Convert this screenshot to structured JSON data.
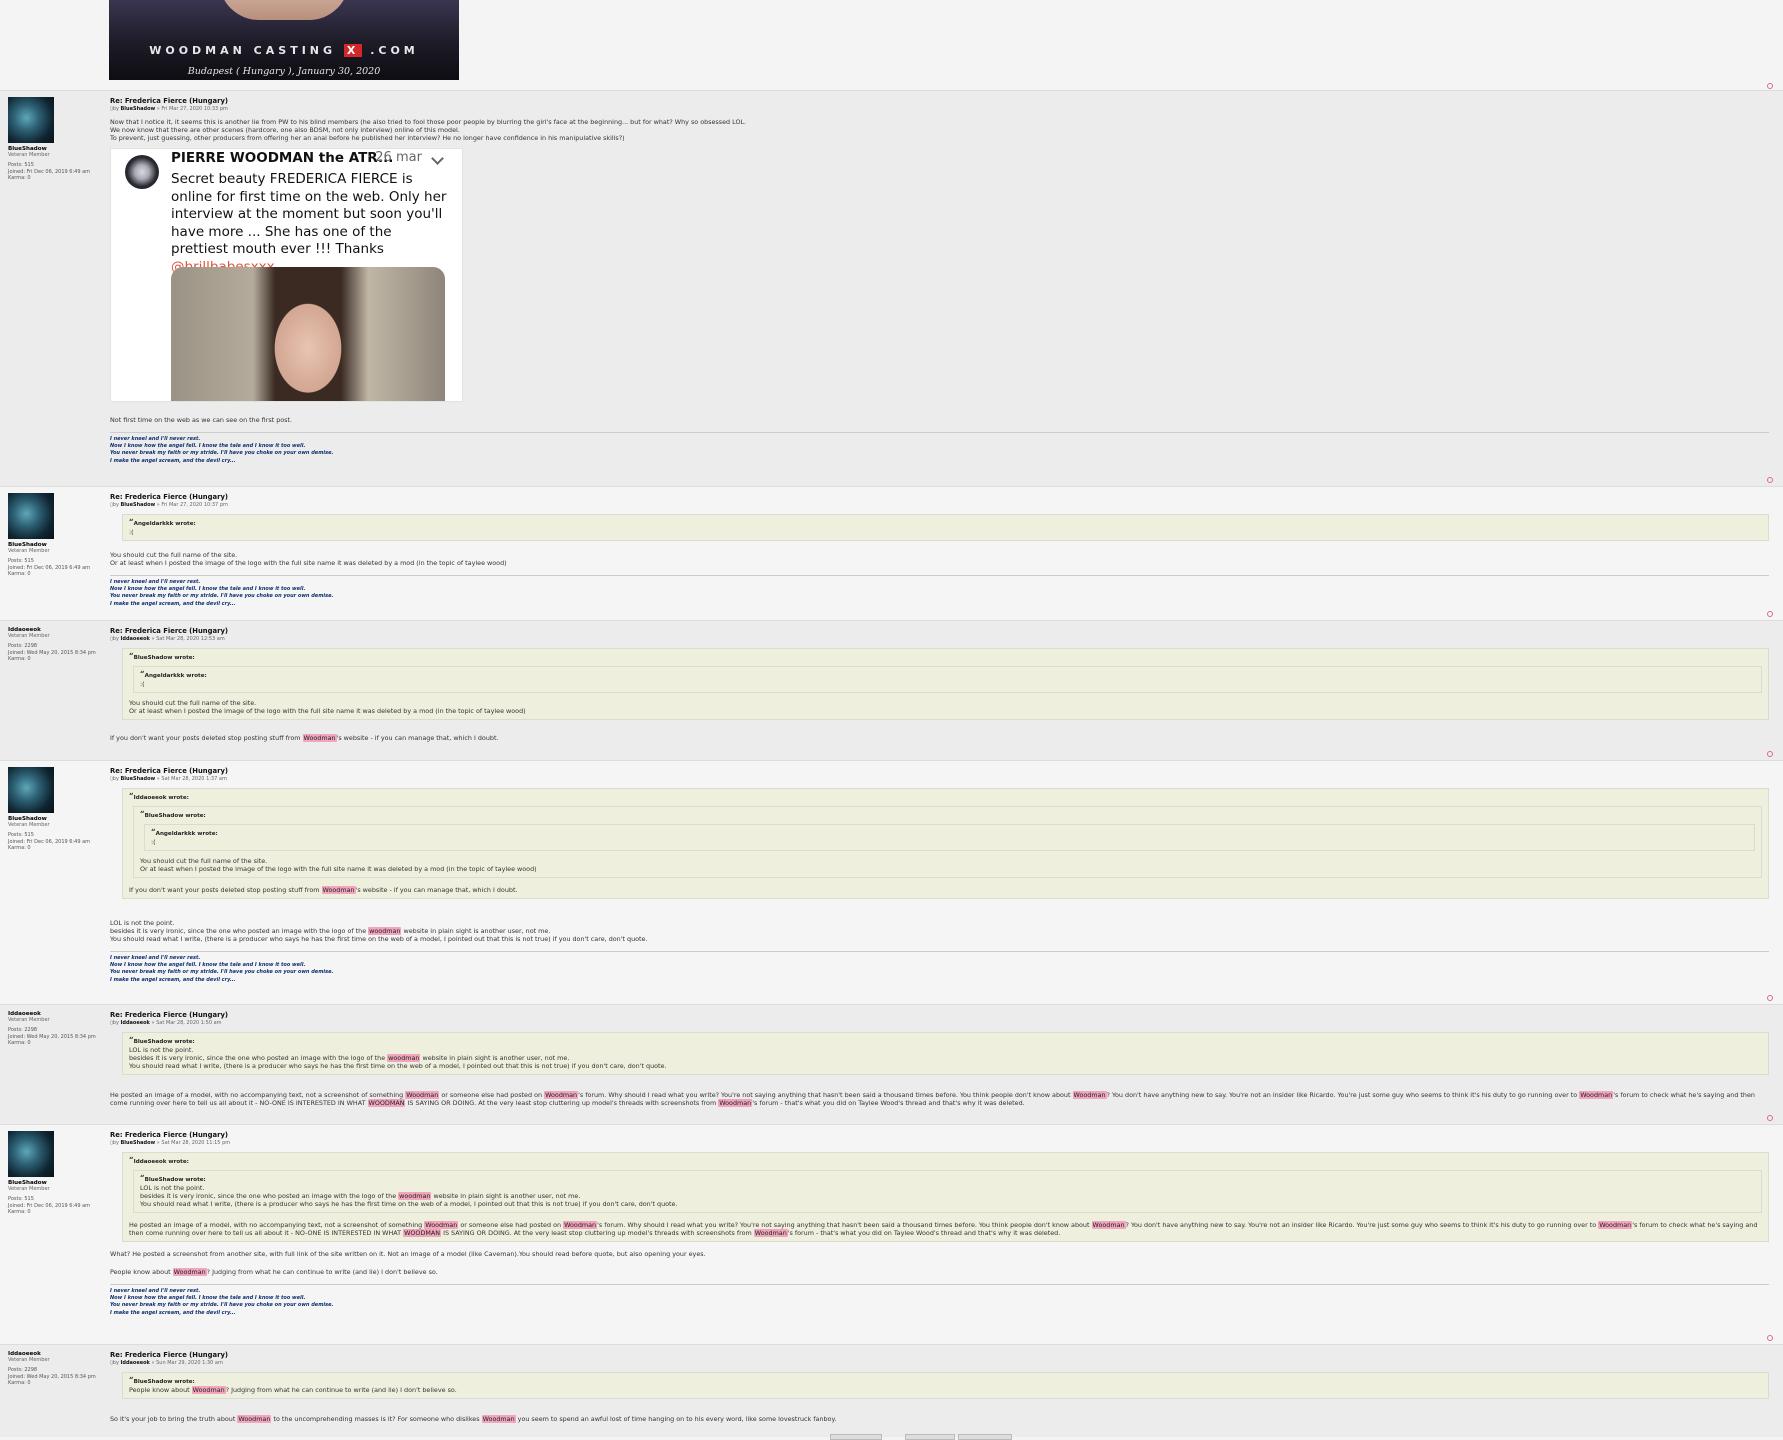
{
  "top_image": {
    "brand_prefix": "WOODMAN CASTING",
    "brand_x": "X",
    "brand_suffix": ".COM",
    "location": "Budapest ( Hungary ), January 30, 2020"
  },
  "signature": [
    "I never kneel and I'll never rest.",
    "Now I know how the angel fell. I know the tale and I know it too well.",
    "You never break my faith or my stride. I'll have you choke on your own demise.",
    "I make the angel scream, and the devil cry..."
  ],
  "users": {
    "blueshadow": {
      "name": "BlueShadow",
      "rank": "Veteran Member",
      "posts": "Posts: 515",
      "joined": "Joined: Fri Dec 06, 2019 6:49 am",
      "karma": "Karma: 0"
    },
    "iddaoeeok": {
      "name": "Iddaoeeok",
      "rank": "Veteran Member",
      "posts": "Posts: 2298",
      "joined": "Joined: Wed May 20, 2015 8:34 pm",
      "karma": "Karma: 0"
    }
  },
  "posts": [
    {
      "title": "Re: Frederica Fierce (Hungary)",
      "by": "by",
      "author": "BlueShadow",
      "date": "» Fri Mar 27, 2020 10:33 pm",
      "lines": [
        "Now that I notice it, it seems this is another lie from PW to his blind members (he also tried to fool those poor people by blurring the girl's face at the beginning... but for what? Why so obsessed LOL.",
        "We now know that there are other scenes (hardcore, one also BDSM, not only interview) online of this model.",
        "To prevent, just guessing, other producers from offering her an anal before he published her interview? He no longer have confidence in his manipulative skills?)"
      ],
      "tweet": {
        "name": "PIERRE WOODMAN the ATR...",
        "date": "· 26 mar",
        "text": "Secret beauty FREDERICA FIERCE is online for first time on the web.  Only her interview at the moment but soon you'll have more ... She has one of the prettiest mouth ever !!! Thanks ",
        "mention": "@brillbabesxxx"
      },
      "after": "Not first time on the web as we can see on the first post."
    },
    {
      "title": "Re: Frederica Fierce (Hungary)",
      "by": "by",
      "author": "BlueShadow",
      "date": "» Fri Mar 27, 2020 10:37 pm",
      "quote_author": "Angeldarkkk wrote:",
      "quote_text": ":(",
      "lines": [
        "You should cut the full name of the site.",
        "Or at least when I posted the image of the logo with the full site name it was deleted by a mod (in the topic of taylee wood)"
      ]
    },
    {
      "title": "Re: Frederica Fierce (Hungary)",
      "by": "by",
      "author": "Iddaoeeok",
      "date": "» Sat Mar 28, 2020 12:53 am",
      "quote_outer_author": "BlueShadow wrote:",
      "quote_inner_author": "Angeldarkkk wrote:",
      "quote_inner_text": ":(",
      "quote_lines": [
        "You should cut the full name of the site.",
        "Or at least when I posted the image of the logo with the full site name it was deleted by a mod (in the topic of taylee wood)"
      ],
      "text_a": "If you don't want your posts deleted stop posting stuff from ",
      "hl": "Woodman",
      "text_b": "'s website - if you can manage that, which I doubt."
    },
    {
      "title": "Re: Frederica Fierce (Hungary)",
      "by": "by",
      "author": "BlueShadow",
      "date": "» Sat Mar 28, 2020 1:37 am",
      "q1_author": "Iddaoeeok wrote:",
      "q2_author": "BlueShadow wrote:",
      "q3_author": "Angeldarkkk wrote:",
      "q3_text": ":(",
      "q2_lines": [
        "You should cut the full name of the site.",
        "Or at least when I posted the image of the logo with the full site name it was deleted by a mod (in the topic of taylee wood)"
      ],
      "q1_text_a": "If you don't want your posts deleted stop posting stuff from ",
      "q1_hl": "Woodman",
      "q1_text_b": "'s website - if you can manage that, which I doubt.",
      "line1": "LOL is not the point.",
      "line2_a": "besides it is very ironic, since the one who posted an image with the logo of the ",
      "line2_hl": "woodman",
      "line2_b": " website in plain sight is another user, not me.",
      "line3": "You should read what I write, (there is a producer who says he has the first time on the web of a model, I pointed out that this is not true) if you don't care, don't quote."
    },
    {
      "title": "Re: Frederica Fierce (Hungary)",
      "by": "by",
      "author": "Iddaoeeok",
      "date": "» Sat Mar 28, 2020 1:50 am",
      "q_author": "BlueShadow wrote:",
      "text_full": [
        "He posted an image of a model, with no accompanying text, not a screenshot of something ",
        "Woodman",
        " or someone else had posted on ",
        "Woodman",
        "'s forum. Why should I read what you write? You're not saying anything that hasn't been said a thousand times before. You think people don't know about ",
        "Woodman",
        "? You don't have anything new to say. You're not an insider like Ricardo. You're just some guy who seems to think it's his duty to go running over to ",
        "Woodman",
        "'s forum to check what he's saying and then come running over here to tell us all about it - NO-ONE IS INTERESTED IN WHAT ",
        "WOODMAN",
        " IS SAYING OR DOING. At the very least stop cluttering up model's threads with screenshots from ",
        "Woodman",
        "'s forum - that's what you did on Taylee Wood's thread and that's why it was deleted."
      ]
    },
    {
      "title": "Re: Frederica Fierce (Hungary)",
      "by": "by",
      "author": "BlueShadow",
      "date": "» Sat Mar 28, 2020 11:15 pm",
      "q_outer_author": "Iddaoeeok wrote:",
      "q_inner_author": "BlueShadow wrote:",
      "after1": "What? He posted a screenshot from another site, with full link of the site written on it. Not an image of a model (like Caveman).You should read before quote, but also opening your eyes.",
      "after2_a": "People know about ",
      "after2_hl": "Woodman",
      "after2_b": "? Judging from what he can continue to write (and lie) I don't believe so."
    },
    {
      "title": "Re: Frederica Fierce (Hungary)",
      "by": "by",
      "author": "Iddaoeeok",
      "date": "» Sun Mar 29, 2020 1:30 am",
      "q_author": "BlueShadow wrote:",
      "q_text_a": "People know about ",
      "q_hl": "Woodman",
      "q_text_b": "? Judging from what he can continue to write (and lie) I don't believe so.",
      "text_a": "So it's your job to bring the truth about ",
      "hl1": "Woodman",
      "text_b": " to the uncomprehending masses is it? For someone who dislikes ",
      "hl2": "Woodman",
      "text_c": " you seem to spend an awful lost of time hanging on to his every word, like some lovestruck fanboy."
    }
  ]
}
